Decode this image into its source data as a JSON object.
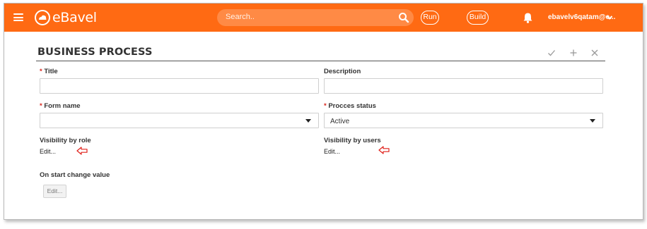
{
  "header": {
    "brand": "eBavel",
    "search_placeholder": "Search..",
    "run_label": "Run",
    "build_label": "Build",
    "user_label": "ebavelv6qatam@e...",
    "accent_color": "#ff6a13"
  },
  "page": {
    "title": "BUSINESS PROCESS",
    "toolbar_icons": [
      "check-icon",
      "plus-icon",
      "close-icon"
    ]
  },
  "form": {
    "required_marker": "*",
    "title_label": "Title",
    "title_value": "",
    "description_label": "Description",
    "description_value": "",
    "form_name_label": "Form name",
    "form_name_value": "",
    "process_status_label": "Procces status",
    "process_status_value": "Active",
    "visibility_role_label": "Visibility by role",
    "visibility_role_edit": "Edit...",
    "visibility_users_label": "Visibility by users",
    "visibility_users_edit": "Edit...",
    "on_start_label": "On start change value",
    "on_start_edit": "Edit..."
  },
  "annotations": {
    "arrow_color": "#e0201a"
  }
}
